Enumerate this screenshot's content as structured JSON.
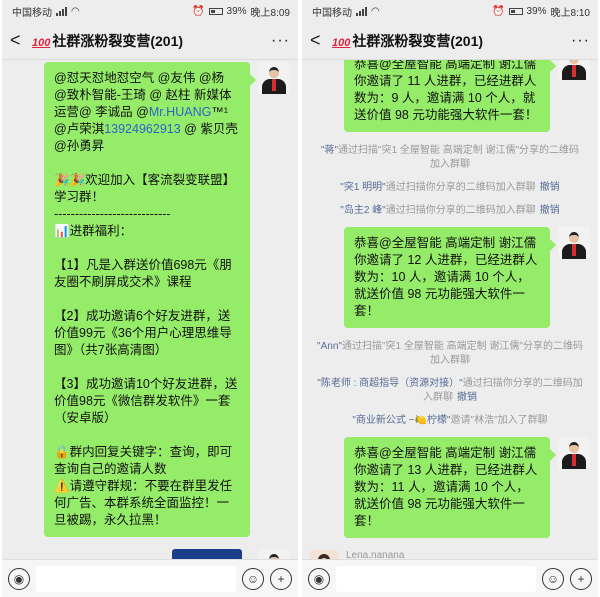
{
  "status": {
    "left": {
      "carrier": "中国移动",
      "time": "晚上8:09",
      "battery": "39%"
    },
    "right": {
      "carrier": "中国移动",
      "time": "晚上8:10",
      "battery": "39%"
    }
  },
  "header": {
    "back_icon": "chevron-left",
    "badge": "100",
    "title": "社群涨粉裂变营(201)",
    "more_icon": "ellipsis"
  },
  "left_chat": {
    "welcome_message": {
      "mentions": "@怼天怼地怼空气 @友伟 @杨 @致朴智能-王琦 @ 赵柱 新媒体运营@ 李诚品 @",
      "mention_link": "Mr.HUANG",
      "mention_tail": "™¹ @卢荣淇",
      "phone_link": "13924962913",
      "mention_rest": " @ 紫贝壳 @孙勇昇",
      "welcome_line": "🎉🎉欢迎加入【客流裂变联盟】学习群！",
      "divider": "----------------------------",
      "benefits_title": "📊进群福利：",
      "benefit1": "【1】凡是入群送价值698元《朋友圈不刷屏成交术》课程",
      "benefit2": "【2】成功邀请6个好友进群，送价值99元《36个用户心理思维导图》（共7张高清图）",
      "benefit3": "【3】成功邀请10个好友进群，送价值98元《微信群发软件》一套（安卓版）",
      "reply_tip": "🔒群内回复关键字：查询，即可查询自己的邀请人数",
      "rule_tip": "⚠️请遵守群规：不要在群里发任何广告、本群系统全面监控！一旦被踢，永久拉黑！"
    }
  },
  "right_chat": {
    "msg_top": "恭喜@全屋智能 高端定制 谢江儒 你邀请了 11 人进群，已经进群人数为：9 人，邀请满 10 个人，就送价值 98 元功能强大软件一套！",
    "sys1": {
      "user": "\"蒋\"",
      "text": "通过扫描\"突1 全屋智能 高端定制 谢江儒\"分享的二维码加入群聊"
    },
    "sys2": {
      "user": "\"突1 明明\"",
      "text": "通过扫描你分享的二维码加入群聊",
      "action": "撤销"
    },
    "sys3": {
      "user": "\"岛主2 峰\"",
      "text": "通过扫描你分享的二维码加入群聊",
      "action": "撤销"
    },
    "msg_mid": "恭喜@全屋智能 高端定制 谢江儒 你邀请了 12 人进群，已经进群人数为：10 人，邀请满 10 个人，就送价值 98 元功能强大软件一套！",
    "sys4": {
      "user": "\"Ann\"",
      "text": "通过扫描\"突1 全屋智能 高端定制 谢江儒\"分享的二维码加入群聊"
    },
    "sys5": {
      "user": "\"陈老师 : 商超指导（资源对接）\"",
      "text": "通过扫描你分享的二维码加入群聊",
      "action": "撤销"
    },
    "sys6": {
      "user": "\"商业新公式 ~🍋柠檬\"",
      "text": "邀请\"林浩\"加入了群聊"
    },
    "msg_bottom": "恭喜@全屋智能 高端定制 谢江儒 你邀请了 13 人进群，已经进群人数为：11 人，邀请满 10 个人，就送价值 98 元功能强大软件一套！",
    "last_sender": "Lena.nanana"
  },
  "input": {
    "voice_icon": "voice",
    "emoji_icon": "emoji",
    "plus_icon": "plus"
  }
}
